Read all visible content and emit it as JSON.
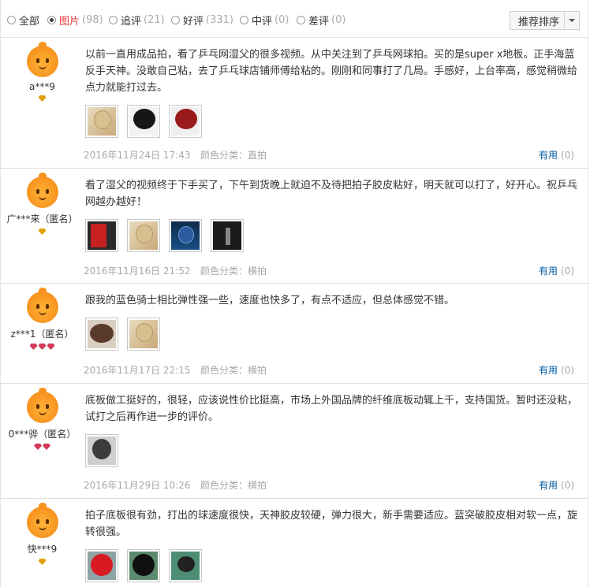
{
  "filters": [
    {
      "label": "全部",
      "count": "",
      "checked": false
    },
    {
      "label": "图片",
      "count": "(98)",
      "checked": true
    },
    {
      "label": "追评",
      "count": "(21)",
      "checked": false
    },
    {
      "label": "好评",
      "count": "(331)",
      "checked": false
    },
    {
      "label": "中评",
      "count": "(0)",
      "checked": false
    },
    {
      "label": "差评",
      "count": "(0)",
      "checked": false
    }
  ],
  "sort": {
    "label": "推荐排序"
  },
  "reviews": [
    {
      "user": "a***9",
      "badge_count": 1,
      "badge_color": "#e2a10a",
      "text": "以前一直用成品拍，看了乒乓网湿父的很多视频。从中关注到了乒乓网球拍。买的是super x地板。正手海蓝反手天神。没敢自己粘，去了乒乓球店铺师傅给粘的。刚刚和同事打了几局。手感好，上台率高，感觉稍微给点力就能打过去。",
      "date": "2016年11月24日 17:43",
      "color_label": "颜色分类：直拍",
      "useful_label": "有用",
      "useful_count": "(0)",
      "images": [
        "img-wood",
        "img-black",
        "img-red"
      ]
    },
    {
      "user": "广***来（匿名）",
      "badge_count": 1,
      "badge_color": "#e2a10a",
      "text": "看了湿父的视频终于下手买了，下午到货晚上就迫不及待把拍子胶皮粘好，明天就可以打了，好开心。祝乒乓网越办越好！",
      "date": "2016年11月16日 21:52",
      "color_label": "颜色分类：横拍",
      "useful_label": "有用",
      "useful_count": "(0)",
      "images": [
        "img-redbox",
        "img-wood",
        "img-blue",
        "img-dark"
      ]
    },
    {
      "user": "z***1（匿名）",
      "badge_count": 3,
      "badge_color": "#d23a58",
      "text": "跟我的蓝色骑士相比弹性强一些，速度也快多了，有点不适应，但总体感觉不错。",
      "date": "2016年11月17日 22:15",
      "color_label": "颜色分类：横拍",
      "useful_label": "有用",
      "useful_count": "(0)",
      "images": [
        "img-brown",
        "img-wood"
      ]
    },
    {
      "user": "0***骅（匿名）",
      "badge_count": 2,
      "badge_color": "#d23a58",
      "text": "底板做工挺好的，很轻，应该说性价比挺高，市场上外国品牌的纤维底板动辄上千，支持国货。暂时还没粘，试打之后再作进一步的评价。",
      "date": "2016年11月29日 10:26",
      "color_label": "颜色分类：横拍",
      "useful_label": "有用",
      "useful_count": "(0)",
      "images": [
        "img-mono"
      ]
    },
    {
      "user": "快***9",
      "badge_count": 1,
      "badge_color": "#e2a10a",
      "text": "拍子底板很有劲，打出的球速度很快，天神胶皮较硬，弹力很大，新手需要适应。蓝突破胶皮相对软一点，旋转很强。",
      "date": "",
      "color_label": "",
      "useful_label": "",
      "useful_count": "",
      "images": [
        "img-redpad",
        "img-blackpad",
        "img-greenpad"
      ]
    }
  ]
}
